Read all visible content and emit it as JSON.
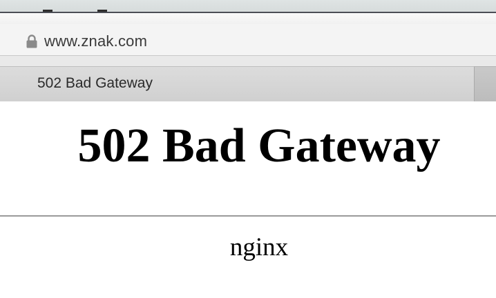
{
  "browser": {
    "address_bar": {
      "url": "www.znak.com",
      "secure_icon": "lock-icon"
    },
    "tab": {
      "title": "502 Bad Gateway"
    }
  },
  "page": {
    "heading": "502 Bad Gateway",
    "server": "nginx"
  },
  "colors": {
    "page_background": "#ffffff",
    "text": "#000000",
    "toolbar": "#f4f4f4",
    "tab_background": "#d6d6d6"
  }
}
